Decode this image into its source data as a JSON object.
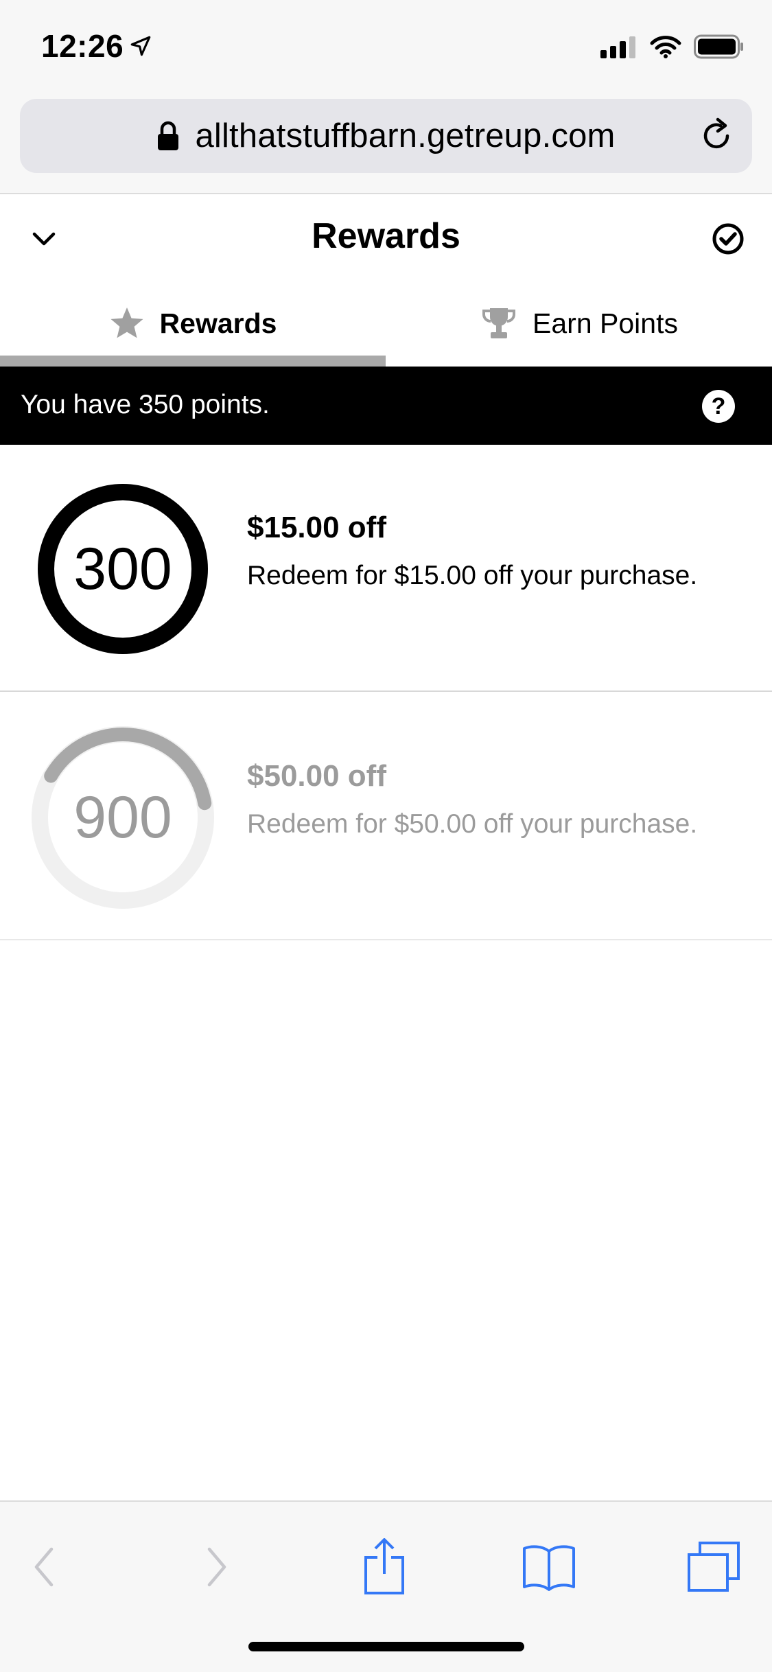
{
  "status_bar": {
    "time": "12:26",
    "location_icon": "location-arrow-icon",
    "icons": [
      "signal-bars-icon",
      "wifi-icon",
      "battery-icon"
    ]
  },
  "browser": {
    "url": "allthatstuffbarn.getreup.com",
    "lock_icon": "lock-icon",
    "reload_icon": "reload-icon"
  },
  "panel": {
    "title": "Rewards",
    "collapse_icon": "chevron-down-icon",
    "done_icon": "check-circle-icon"
  },
  "tabs": [
    {
      "label": "Rewards",
      "icon": "star-icon",
      "active": true
    },
    {
      "label": "Earn Points",
      "icon": "trophy-icon",
      "active": false
    }
  ],
  "points_banner": {
    "text": "You have 350 points.",
    "help_label": "?"
  },
  "rewards": [
    {
      "points": "300",
      "title": "$15.00 off",
      "description": "Redeem for $15.00 off your purchase.",
      "progress": 1.0,
      "available": true
    },
    {
      "points": "900",
      "title": "$50.00 off",
      "description": "Redeem for $50.00 off your purchase.",
      "progress": 0.389,
      "available": false
    }
  ],
  "toolbar": {
    "items": [
      "back-icon",
      "forward-icon",
      "share-icon",
      "bookmarks-icon",
      "tabs-icon"
    ]
  },
  "colors": {
    "banner_bg": "#000000",
    "tab_underline": "#a9a9a9",
    "disabled_text": "#9b9b9b",
    "ios_blue": "#3478f6"
  }
}
